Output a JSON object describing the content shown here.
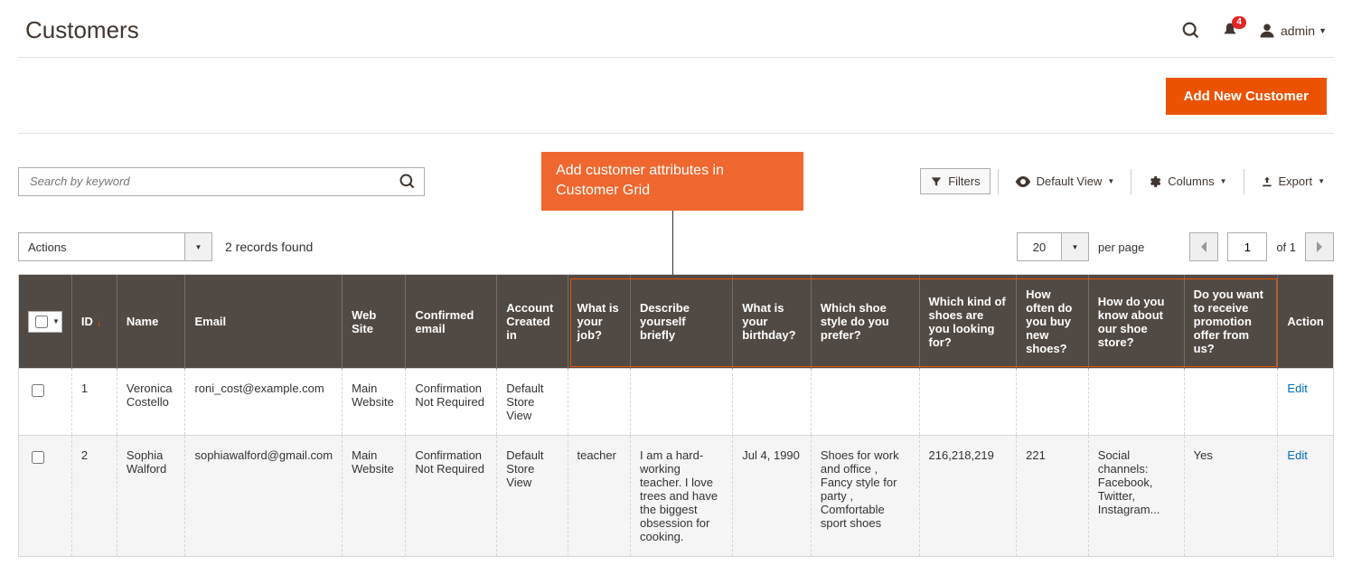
{
  "header": {
    "title": "Customers",
    "notif_count": "4",
    "user_label": "admin"
  },
  "actionbar": {
    "add_customer": "Add New Customer"
  },
  "toolbar": {
    "search_placeholder": "Search by keyword",
    "callout_text": "Add customer attributes in Customer Grid",
    "filters": "Filters",
    "default_view": "Default View",
    "columns": "Columns",
    "export": "Export"
  },
  "toolbar2": {
    "actions_label": "Actions",
    "records_found": "2 records found",
    "page_size": "20",
    "per_page": "per page",
    "current_page": "1",
    "of_label": "of 1"
  },
  "columns": {
    "id": "ID",
    "name": "Name",
    "email": "Email",
    "website": "Web Site",
    "confirmed": "Confirmed email",
    "created_in": "Account Created in",
    "job": "What is your job?",
    "describe": "Describe yourself briefly",
    "birthday": "What is your birthday?",
    "shoe_style": "Which shoe style do you prefer?",
    "shoe_kind": "Which kind of shoes are you looking for?",
    "how_often": "How often do you buy new shoes?",
    "how_know": "How do you know about our shoe store?",
    "promo": "Do you want to receive promotion offer from us?",
    "action": "Action"
  },
  "rows": [
    {
      "id": "1",
      "name": "Veronica Costello",
      "email": "roni_cost@example.com",
      "website": "Main Website",
      "confirmed": "Confirmation Not Required",
      "created_in": "Default Store View",
      "job": "",
      "describe": "",
      "birthday": "",
      "shoe_style": "",
      "shoe_kind": "",
      "how_often": "",
      "how_know": "",
      "promo": "",
      "action": "Edit"
    },
    {
      "id": "2",
      "name": "Sophia Walford",
      "email": "sophiawalford@gmail.com",
      "website": "Main Website",
      "confirmed": "Confirmation Not Required",
      "created_in": "Default Store View",
      "job": "teacher",
      "describe": "I am a hard-working teacher. I love trees and have the biggest obsession for cooking.",
      "birthday": "Jul 4, 1990",
      "shoe_style": "Shoes for work and office , Fancy style for party , Comfortable sport shoes",
      "shoe_kind": "216,218,219",
      "how_often": "221",
      "how_know": "Social channels: Facebook, Twitter, Instagram...",
      "promo": "Yes",
      "action": "Edit"
    }
  ]
}
